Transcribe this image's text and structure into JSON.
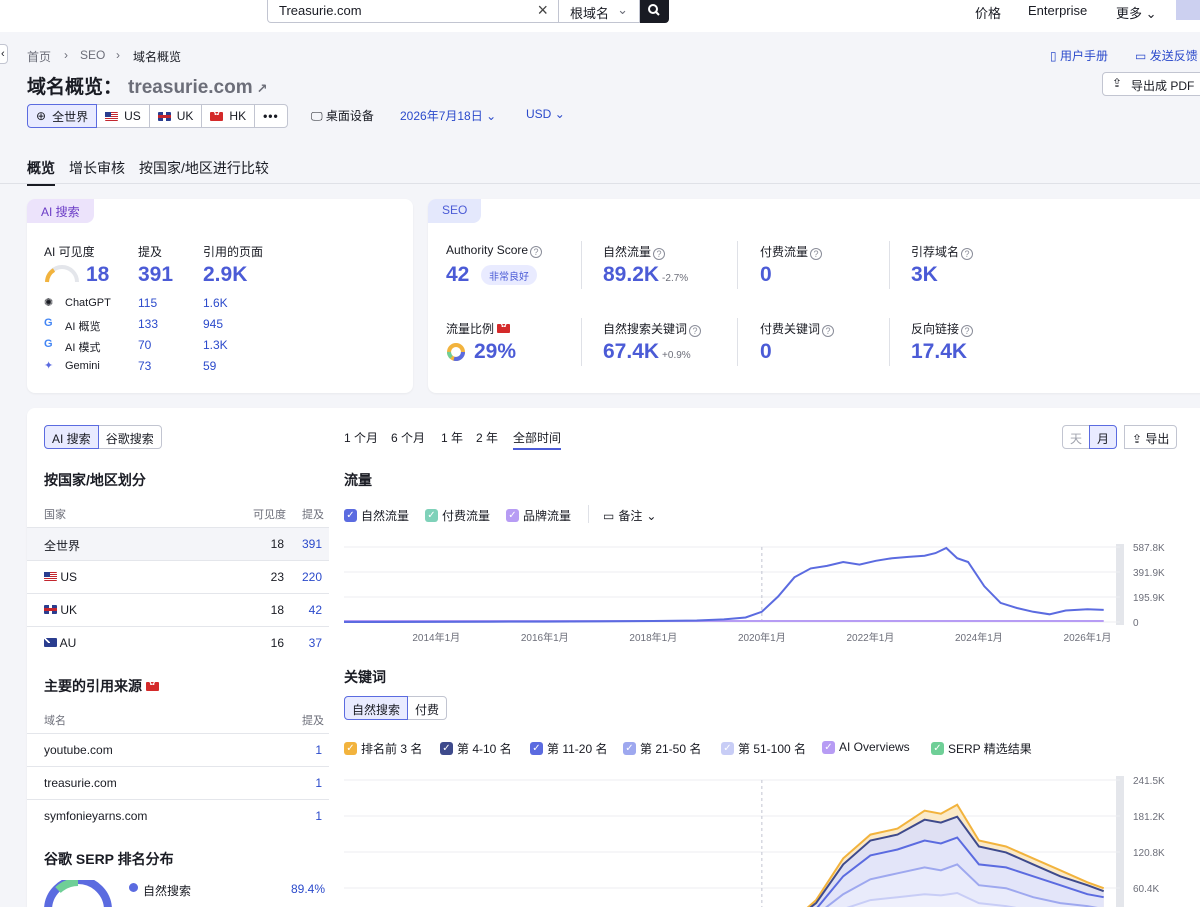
{
  "topbar": {
    "search_value": "Treasurie.com",
    "root_select": "根域名",
    "nav": [
      "价格",
      "Enterprise",
      "更多"
    ]
  },
  "breadcrumb": [
    "首页",
    "SEO",
    "域名概览"
  ],
  "page_title": "域名概览：",
  "page_domain": "treasurie.com",
  "header_links": {
    "manual": "用户手册",
    "feedback": "发送反馈",
    "pdf": "导出成 PDF"
  },
  "regions": [
    "全世界",
    "US",
    "UK",
    "HK"
  ],
  "device": "桌面设备",
  "date": "2026年7月18日",
  "currency": "USD",
  "tabs": [
    "概览",
    "增长审核",
    "按国家/地区进行比较"
  ],
  "ai_card": {
    "pill": "AI 搜索",
    "headers": [
      "AI 可见度",
      "提及",
      "引用的页面"
    ],
    "visibility": "18",
    "mentions": "391",
    "cited_pages": "2.9K",
    "rows": [
      {
        "name": "ChatGPT",
        "mentions": "115",
        "pages": "1.6K"
      },
      {
        "name": "AI 概览",
        "mentions": "133",
        "pages": "945"
      },
      {
        "name": "AI 模式",
        "mentions": "70",
        "pages": "1.3K"
      },
      {
        "name": "Gemini",
        "mentions": "73",
        "pages": "59"
      }
    ]
  },
  "seo_card": {
    "pill": "SEO",
    "authority_label": "Authority Score",
    "authority_value": "42",
    "authority_badge": "非常良好",
    "organic_label": "自然流量",
    "organic_value": "89.2K",
    "organic_change": "-2.7%",
    "paid_label": "付费流量",
    "paid_value": "0",
    "ref_domains_label": "引荐域名",
    "ref_domains_value": "3K",
    "traffic_share_label": "流量比例",
    "traffic_share_value": "29%",
    "organic_kw_label": "自然搜索关键词",
    "organic_kw_value": "67.4K",
    "organic_kw_change": "+0.9%",
    "paid_kw_label": "付费关键词",
    "paid_kw_value": "0",
    "backlinks_label": "反向链接",
    "backlinks_value": "17.4K"
  },
  "left_panel": {
    "toggle": [
      "AI 搜索",
      "谷歌搜索"
    ],
    "by_country_title": "按国家/地区划分",
    "country_headers": [
      "国家",
      "可见度",
      "提及"
    ],
    "countries": [
      {
        "name": "全世界",
        "vis": "18",
        "mentions": "391"
      },
      {
        "name": "US",
        "vis": "23",
        "mentions": "220"
      },
      {
        "name": "UK",
        "vis": "18",
        "mentions": "42"
      },
      {
        "name": "AU",
        "vis": "16",
        "mentions": "37"
      }
    ],
    "sources_title": "主要的引用来源",
    "source_headers": [
      "域名",
      "提及"
    ],
    "sources": [
      {
        "domain": "youtube.com",
        "mentions": "1"
      },
      {
        "domain": "treasurie.com",
        "mentions": "1"
      },
      {
        "domain": "symfonieyarns.com",
        "mentions": "1"
      }
    ],
    "serp_title": "谷歌 SERP 排名分布",
    "serp_legend": "自然搜索",
    "serp_value": "89.4%"
  },
  "chart_controls": {
    "periods": [
      "1 个月",
      "6 个月",
      "1 年",
      "2 年",
      "全部时间"
    ],
    "granularity": [
      "天",
      "月"
    ],
    "export": "导出",
    "traffic_title": "流量",
    "traffic_legend": [
      "自然流量",
      "付费流量",
      "品牌流量"
    ],
    "notes": "备注",
    "keywords_title": "关键词",
    "kw_toggle": [
      "自然搜索",
      "付费"
    ],
    "kw_legend": [
      "排名前 3 名",
      "第 4-10 名",
      "第 11-20 名",
      "第 21-50 名",
      "第 51-100 名",
      "AI Overviews",
      "SERP 精选结果"
    ]
  },
  "colors": {
    "accent": "#4b5bd6",
    "line": "#5b6be0",
    "brand": "#a68bf0",
    "top3": "#f2b33d"
  },
  "chart_data": [
    {
      "type": "line",
      "title": "流量",
      "x_ticks": [
        "2014年1月",
        "2016年1月",
        "2018年1月",
        "2020年1月",
        "2022年1月",
        "2024年1月",
        "2026年1月"
      ],
      "y_ticks": [
        "0",
        "195.9K",
        "391.9K",
        "587.8K"
      ],
      "ylim": [
        0,
        587800
      ],
      "series": [
        {
          "name": "自然流量",
          "x": [
            2012.3,
            2013,
            2014,
            2015,
            2016,
            2017,
            2018,
            2018.8,
            2019.3,
            2019.7,
            2020,
            2020.3,
            2020.6,
            2020.9,
            2021.2,
            2021.5,
            2021.8,
            2022.1,
            2022.4,
            2022.7,
            2023,
            2023.2,
            2023.4,
            2023.6,
            2023.8,
            2024.1,
            2024.4,
            2024.7,
            2025,
            2025.3,
            2025.6,
            2026,
            2026.3
          ],
          "values": [
            0,
            0,
            1000,
            2000,
            3000,
            5000,
            8000,
            12000,
            20000,
            35000,
            80000,
            200000,
            350000,
            420000,
            440000,
            470000,
            450000,
            480000,
            500000,
            510000,
            520000,
            540000,
            580000,
            500000,
            470000,
            280000,
            150000,
            110000,
            80000,
            60000,
            90000,
            100000,
            95000
          ]
        },
        {
          "name": "品牌流量",
          "x": [
            2012.3,
            2026.3
          ],
          "values": [
            8000,
            8000
          ]
        }
      ]
    },
    {
      "type": "area",
      "title": "关键词",
      "y_ticks": [
        "60.4K",
        "120.8K",
        "181.2K",
        "241.5K"
      ],
      "ylim": [
        0,
        241500
      ],
      "series": [
        {
          "name": "排名前 3 名",
          "x": [
            2020.5,
            2021,
            2021.5,
            2022,
            2022.5,
            2023,
            2023.3,
            2023.6,
            2024,
            2024.5,
            2025,
            2025.5,
            2026,
            2026.3
          ],
          "values": [
            0,
            40000,
            110000,
            150000,
            160000,
            190000,
            185000,
            200000,
            140000,
            130000,
            110000,
            90000,
            70000,
            60000
          ]
        },
        {
          "name": "第 4-10 名",
          "x": [
            2020.5,
            2021,
            2021.5,
            2022,
            2022.5,
            2023,
            2023.3,
            2023.6,
            2024,
            2024.5,
            2025,
            2025.5,
            2026,
            2026.3
          ],
          "values": [
            0,
            35000,
            100000,
            140000,
            150000,
            175000,
            170000,
            180000,
            130000,
            120000,
            100000,
            80000,
            65000,
            55000
          ]
        },
        {
          "name": "第 11-20 名",
          "x": [
            2020.5,
            2021,
            2021.5,
            2022,
            2022.5,
            2023,
            2023.3,
            2023.6,
            2024,
            2024.5,
            2025,
            2025.5,
            2026,
            2026.3
          ],
          "values": [
            0,
            25000,
            80000,
            115000,
            125000,
            140000,
            135000,
            145000,
            100000,
            95000,
            80000,
            65000,
            50000,
            45000
          ]
        },
        {
          "name": "第 21-50 名",
          "x": [
            2020.5,
            2021,
            2021.5,
            2022,
            2022.5,
            2023,
            2023.3,
            2023.6,
            2024,
            2024.5,
            2025,
            2025.5,
            2026,
            2026.3
          ],
          "values": [
            0,
            15000,
            50000,
            75000,
            85000,
            95000,
            90000,
            100000,
            65000,
            60000,
            45000,
            35000,
            30000,
            25000
          ]
        },
        {
          "name": "第 51-100 名",
          "x": [
            2020.5,
            2021,
            2021.5,
            2022,
            2022.5,
            2023,
            2023.3,
            2023.6,
            2024,
            2024.5,
            2025,
            2025.5,
            2026,
            2026.3
          ],
          "values": [
            0,
            8000,
            25000,
            40000,
            45000,
            50000,
            48000,
            52000,
            35000,
            30000,
            22000,
            15000,
            12000,
            10000
          ]
        }
      ]
    }
  ]
}
